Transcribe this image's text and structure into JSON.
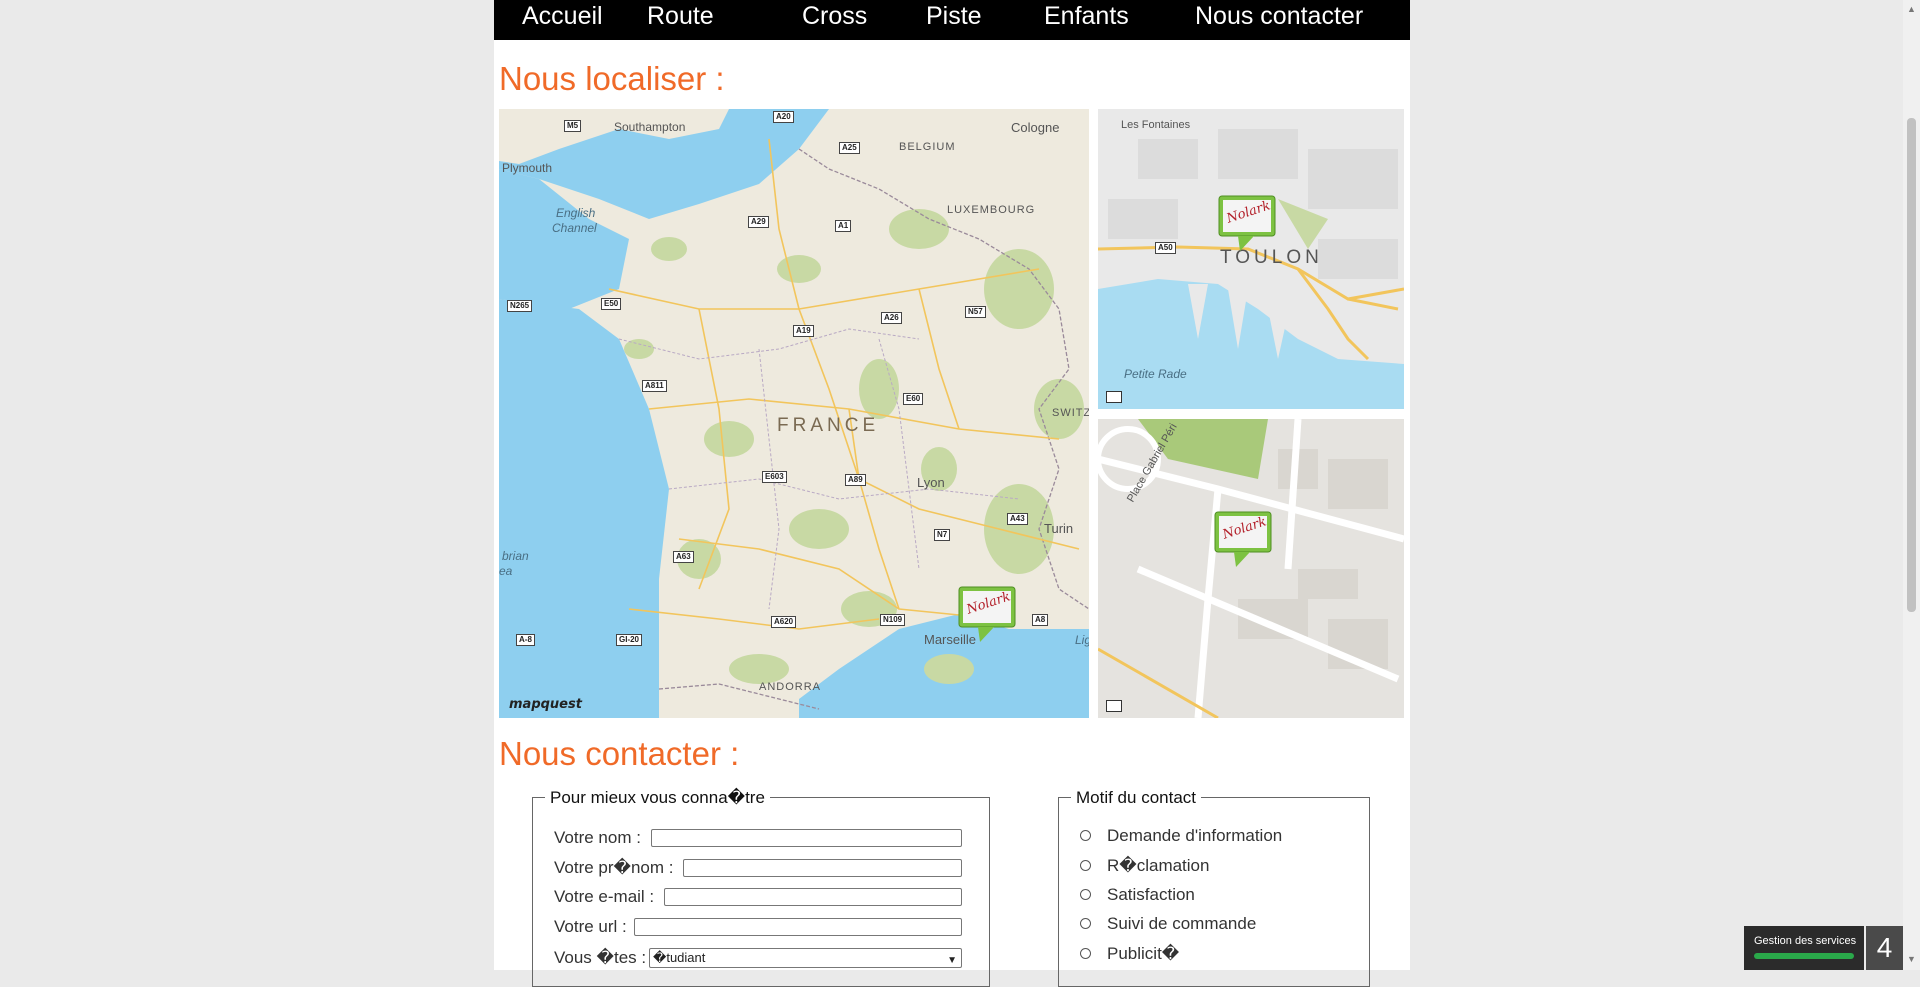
{
  "nav": {
    "items": [
      "Accueil",
      "Route",
      "Cross",
      "Piste",
      "Enfants",
      "Nous contacter"
    ]
  },
  "locate_section": {
    "title": "Nous localiser :"
  },
  "map_france": {
    "labels": [
      "Southampton",
      "Plymouth",
      "English",
      "Channel",
      "BELGIUM",
      "LUXEMBOURG",
      "Cologne",
      "FRANCE",
      "Lyon",
      "Turin",
      "SWITZ",
      "Marseille",
      "ANDORRA",
      "brian",
      "ea",
      "Lig"
    ],
    "road_shields": [
      "M5",
      "A20",
      "A29",
      "A1",
      "A26",
      "E50",
      "N265",
      "A19",
      "A26",
      "N57",
      "A811",
      "E60",
      "E603",
      "A89",
      "A43",
      "N7",
      "A63",
      "A620",
      "N109",
      "A8",
      "A-8",
      "GI-20",
      "A25"
    ],
    "watermark": "mapquest",
    "marker_text": "Nolark"
  },
  "map_toulon": {
    "labels": [
      "Les Fontaines",
      "TOULON",
      "Petite Rade"
    ],
    "road_shields": [
      "A50"
    ],
    "marker_text": "Nolark"
  },
  "map_street": {
    "labels": [
      "Place Gabriel Péri"
    ],
    "marker_text": "Nolark"
  },
  "contact_section": {
    "title": "Nous contacter :"
  },
  "form_identity": {
    "legend": "Pour mieux vous conna�tre",
    "fields": [
      {
        "label": "Votre nom :",
        "value": ""
      },
      {
        "label": "Votre pr�nom :",
        "value": ""
      },
      {
        "label": "Votre e-mail :",
        "value": ""
      },
      {
        "label": "Votre url :",
        "value": ""
      }
    ],
    "status_label": "Vous �tes :",
    "status_value": "�tudiant"
  },
  "form_motif": {
    "legend": "Motif du contact",
    "options": [
      "Demande d'information",
      "R�clamation",
      "Satisfaction",
      "Suivi de commande",
      "Publicit�"
    ]
  },
  "widget": {
    "label": "Gestion des services",
    "count": "4"
  },
  "colors": {
    "accent": "#f06a28",
    "nav_bg": "#000000",
    "marker_green": "#7dc242",
    "sea": "#8ecfef"
  }
}
